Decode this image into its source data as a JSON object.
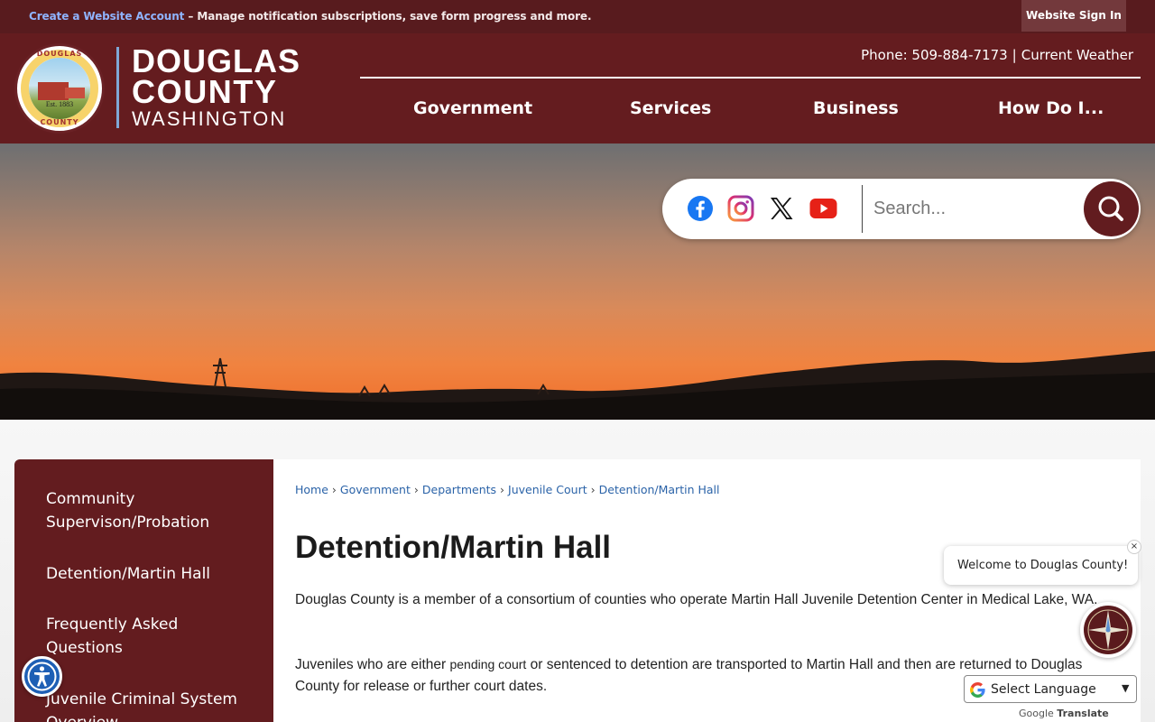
{
  "topbar": {
    "create_account": "Create a Website Account",
    "message": " – Manage notification subscriptions, save form progress and more.",
    "signin": "Website Sign In"
  },
  "logo": {
    "line1": "DOUGLAS",
    "line2": "COUNTY",
    "line3": "WASHINGTON",
    "seal_top": "DOUGLAS",
    "seal_bottom": "COUNTY",
    "seal_est": "Est. 1883"
  },
  "contact": {
    "phone": "Phone: 509-884-7173",
    "separator": "|",
    "weather": "Current Weather"
  },
  "nav": [
    "Government",
    "Services",
    "Business",
    "How Do I..."
  ],
  "search": {
    "placeholder": "Search..."
  },
  "social": [
    "facebook-icon",
    "instagram-icon",
    "x-icon",
    "youtube-icon"
  ],
  "sidebar": {
    "items": [
      {
        "label": "Community Supervison/Probation"
      },
      {
        "label": "Detention/Martin Hall"
      },
      {
        "label": "Frequently Asked Questions"
      },
      {
        "label": "Juvenile Criminal System Overview"
      }
    ]
  },
  "breadcrumb": {
    "items": [
      "Home",
      "Government",
      "Departments",
      "Juvenile Court",
      "Detention/Martin Hall"
    ],
    "sep": "›"
  },
  "page": {
    "title": "Detention/Martin Hall",
    "para1": "Douglas County is a member of a consortium of counties who operate Martin Hall Juvenile Detention Center in Medical Lake, WA.",
    "para2_a": "Juveniles who are either ",
    "para2_b": "pending court",
    "para2_c": " or sentenced to detention are transported to Martin Hall and then are returned to Douglas County for release or further court dates."
  },
  "chat": {
    "welcome": "Welcome to Douglas County!",
    "close": "×"
  },
  "translate": {
    "label": "Select Language",
    "powered_by": "Google",
    "translate_word": "Translate"
  },
  "colors": {
    "maroon": "#641c1f",
    "topbar": "#581b1e",
    "link": "#2b63a8",
    "accessibility": "#1d5fb5"
  }
}
